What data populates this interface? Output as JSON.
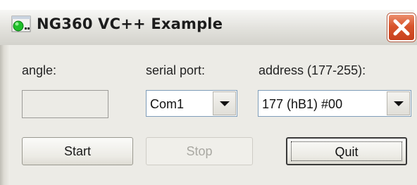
{
  "window": {
    "title": "NG360 VC++ Example"
  },
  "labels": {
    "angle": "angle:",
    "serial_port": "serial port:",
    "address": "address (177-255):"
  },
  "angle_value": "",
  "serial_port": {
    "selected": "Com1"
  },
  "address": {
    "selected": "177 (hB1) #00"
  },
  "buttons": {
    "start": "Start",
    "stop": "Stop",
    "quit": "Quit"
  },
  "icons": {
    "app": "app-icon",
    "close": "close-icon",
    "dropdown": "chevron-down-icon"
  },
  "colors": {
    "close_button": "#d8542c",
    "client_bg": "#ecebe6"
  }
}
